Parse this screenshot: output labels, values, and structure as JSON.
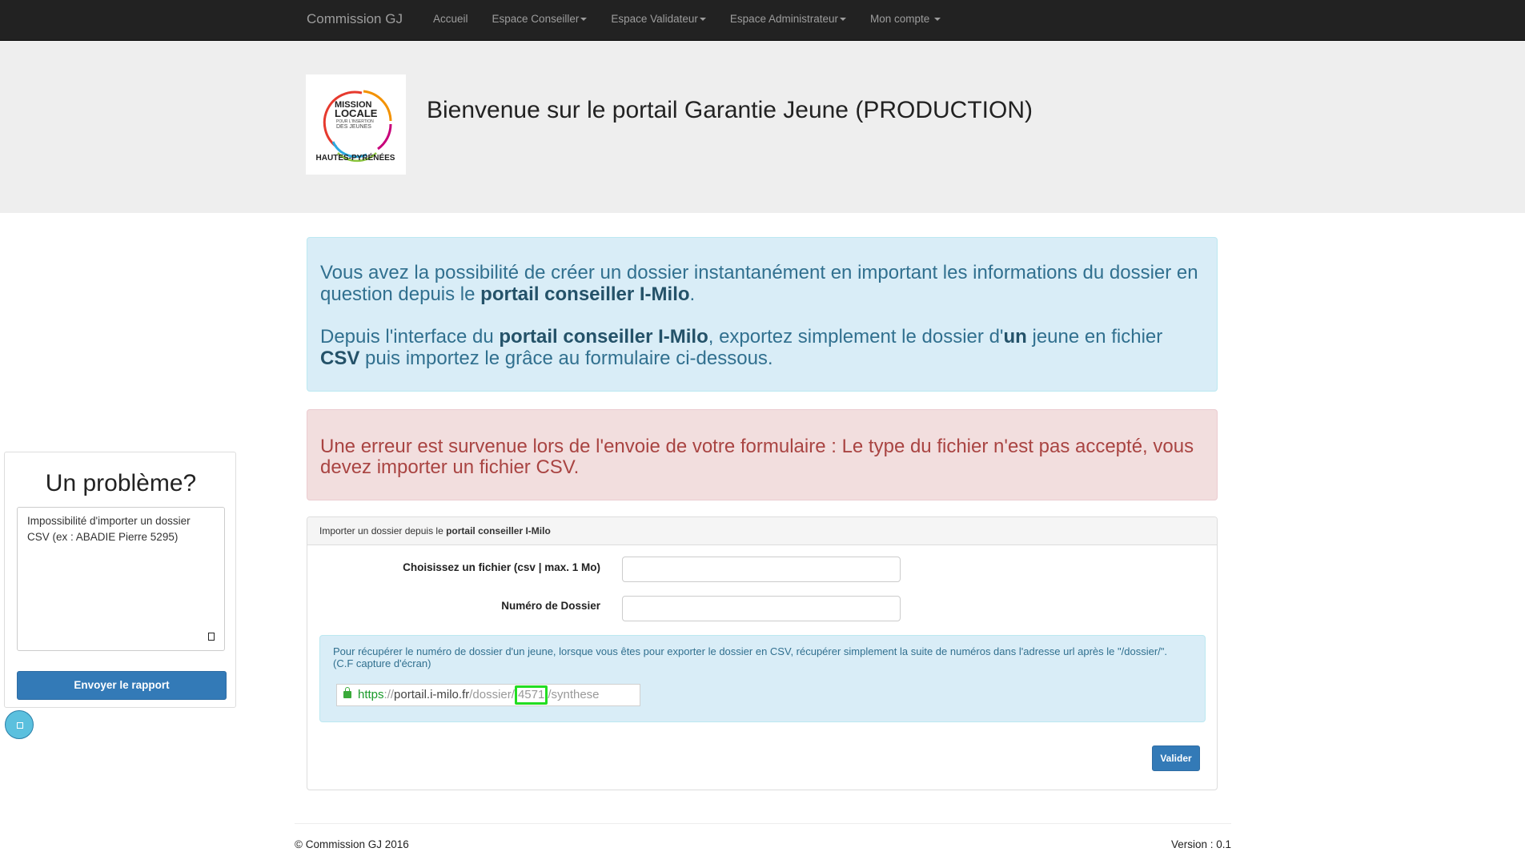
{
  "navbar": {
    "brand": "Commission GJ",
    "items": [
      {
        "label": "Accueil",
        "dropdown": false
      },
      {
        "label": "Espace Conseiller",
        "dropdown": true
      },
      {
        "label": "Espace Validateur",
        "dropdown": true
      },
      {
        "label": "Espace Administrateur",
        "dropdown": true
      },
      {
        "label": "Mon compte",
        "dropdown": true
      }
    ]
  },
  "header": {
    "logo": {
      "line1": "MISSION",
      "line2": "LOCALE",
      "line3": "POUR L'INSERTION",
      "line4": "DES JEUNES",
      "region": "HAUTES-PYRÉNÉES"
    },
    "title": "Bienvenue sur le portail Garantie Jeune (PRODUCTION)"
  },
  "info_alert": {
    "p1_a": "Vous avez la possibilité de créer un dossier instantanément en important les informations du dossier en question depuis le ",
    "p1_b": "portail conseiller I-Milo",
    "p1_c": ".",
    "p2_a": "Depuis l'interface du ",
    "p2_b": "portail conseiller I-Milo",
    "p2_c": ", exportez simplement le dossier d'",
    "p2_d": "un",
    "p2_e": " jeune en fichier ",
    "p2_f": "CSV",
    "p2_g": " puis importez le grâce au formulaire ci-dessous."
  },
  "error_alert": {
    "text": "Une erreur est survenue lors de l'envoie de votre formulaire : Le type du fichier n'est pas accepté, vous devez importer un fichier CSV."
  },
  "import_panel": {
    "heading_a": "Importer un dossier depuis le ",
    "heading_b": "portail conseiller I-Milo",
    "file_label": "Choisissez un fichier (csv | max. 1 Mo)",
    "file_value": "",
    "dossier_label": "Numéro de Dossier",
    "dossier_value": "",
    "help_text": "Pour récupérer le numéro de dossier d'un jeune, lorsque vous êtes pour exporter le dossier en CSV, récupérer simplement la suite de numéros dans l'adresse url après le \"/dossier/\". (C.F capture d'écran)",
    "url_https": "https",
    "url_sep": "://",
    "url_host": "portail.i-milo.fr",
    "url_path": "/dossier/",
    "url_number": "4571",
    "url_suffix": "/synthese",
    "submit_label": "Valider"
  },
  "footer": {
    "copyright": "© Commission GJ 2016",
    "version": "Version : 0.1"
  },
  "feedback": {
    "title": "Un problème?",
    "message": "Impossibilité d'importer un dossier CSV (ex : ABADIE Pierre 5295)",
    "button_label": "Envoyer le rapport"
  },
  "colors": {
    "navbar": "#222222",
    "jumbotron": "#eeeeee",
    "info_bg": "#d9edf7",
    "info_text": "#31708f",
    "danger_bg": "#f2dede",
    "danger_text": "#a94442",
    "primary": "#337ab7",
    "highlight": "#22dd22"
  }
}
